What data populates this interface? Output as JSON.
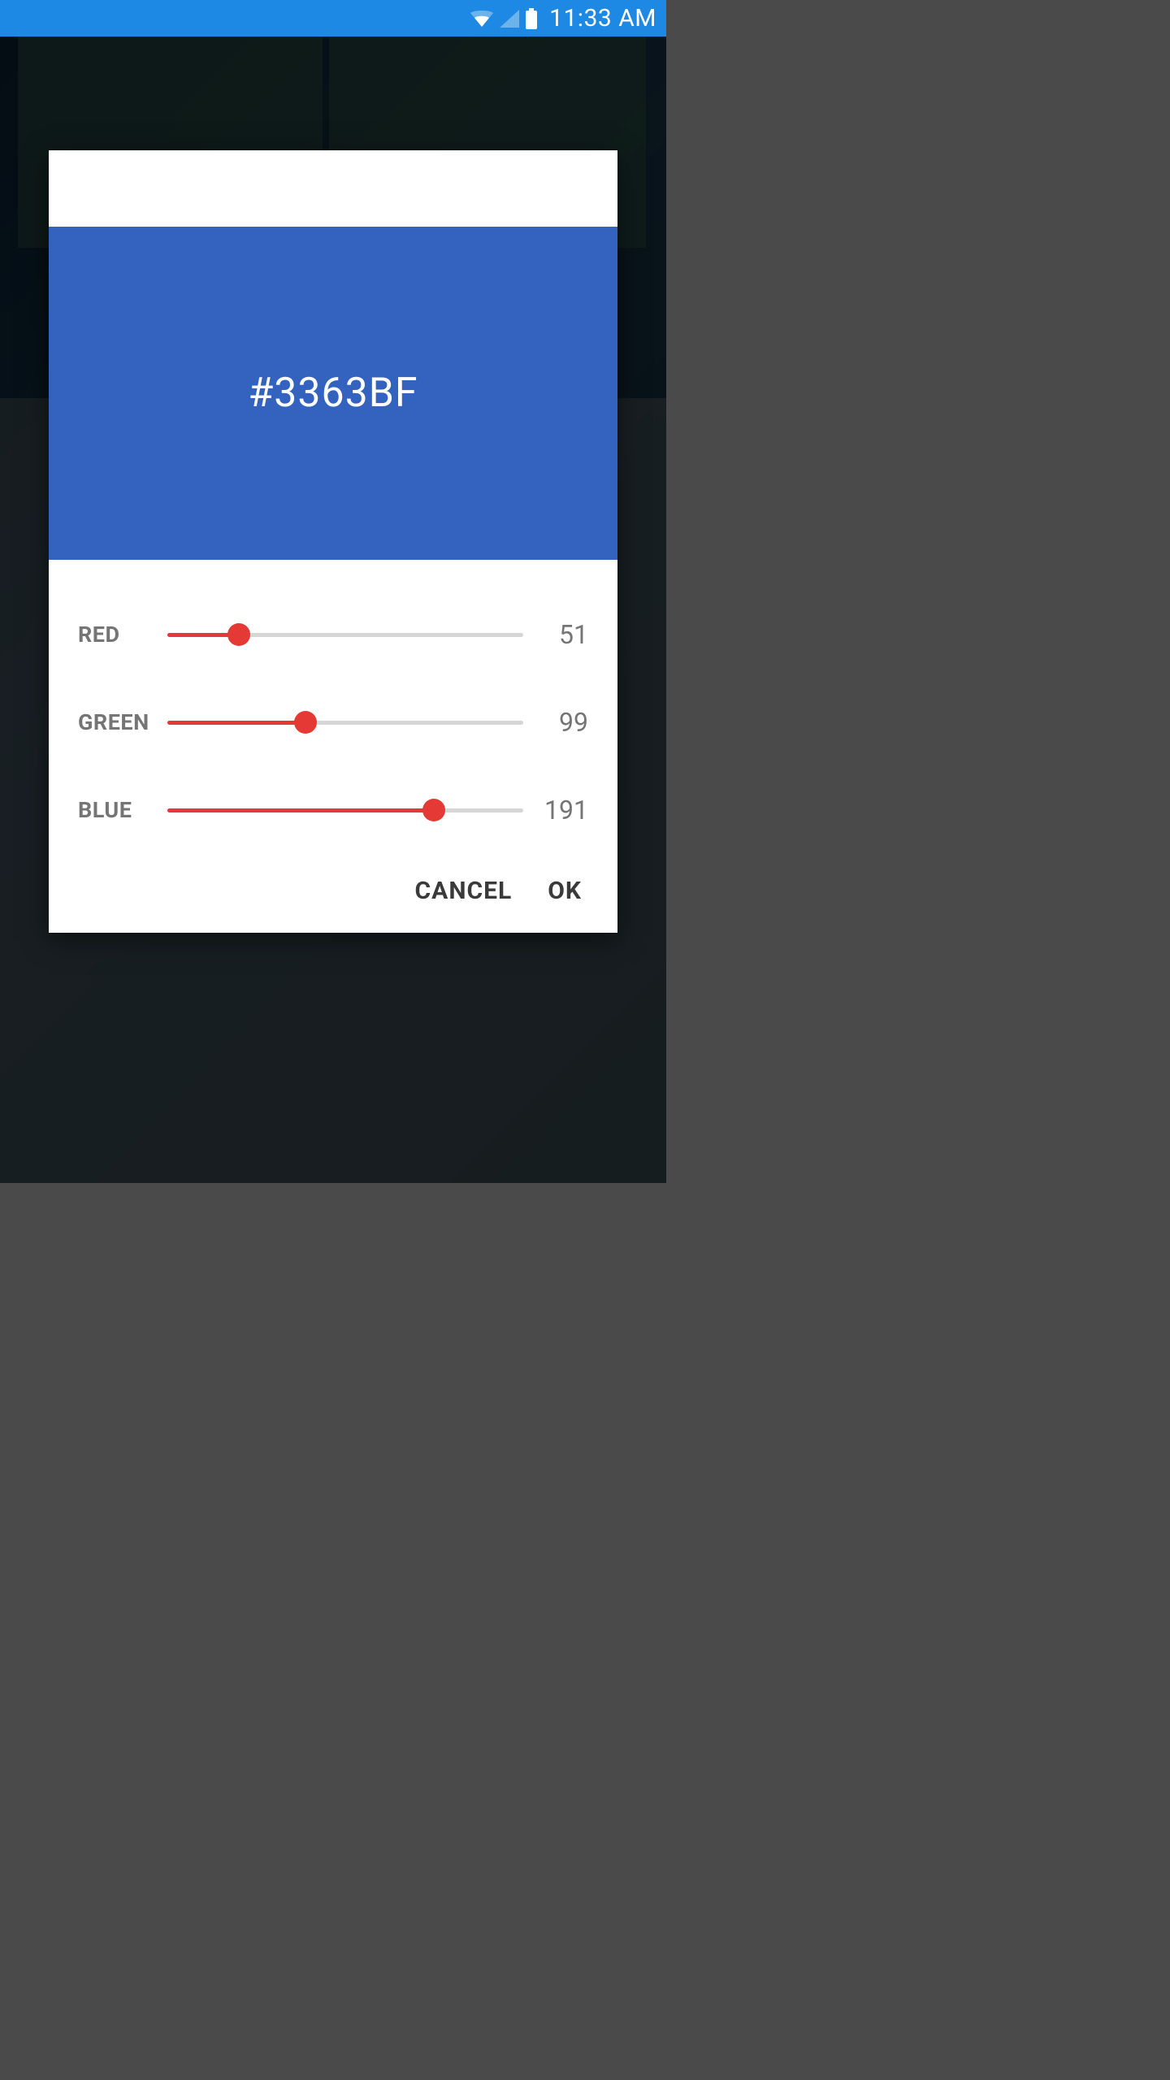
{
  "status_bar": {
    "time": "11:33 AM"
  },
  "dialog": {
    "hex": "#3363BF",
    "swatch_color": "#3363BF",
    "sliders": {
      "red": {
        "label": "RED",
        "value": 51,
        "max": 255
      },
      "green": {
        "label": "GREEN",
        "value": 99,
        "max": 255
      },
      "blue": {
        "label": "BLUE",
        "value": 191,
        "max": 255
      }
    },
    "buttons": {
      "cancel": "CANCEL",
      "ok": "OK"
    }
  }
}
